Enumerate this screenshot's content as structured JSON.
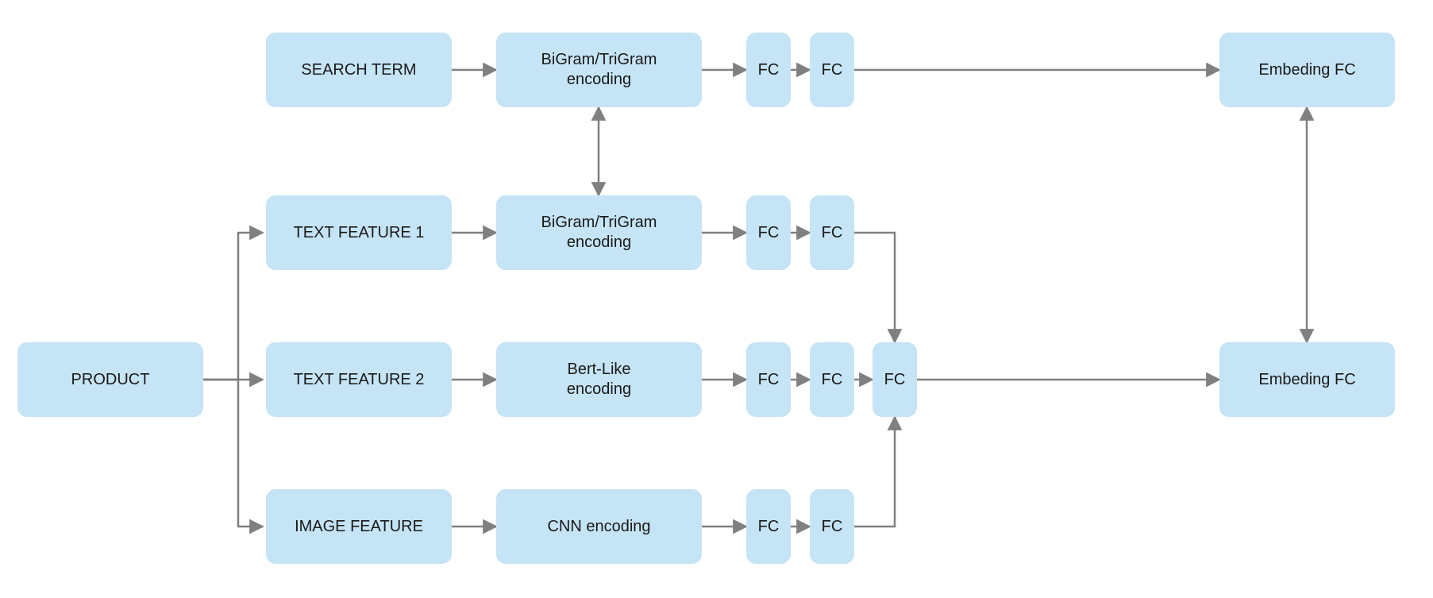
{
  "diagram": {
    "description": "Two-tower style embedding architecture: search term branch and product branch (text + image features) each pass through encoders and FC layers to produce embedding FCs.",
    "nodes": {
      "search_term": {
        "label": "SEARCH TERM"
      },
      "search_enc": {
        "label": "BiGram/TriGram\nencoding"
      },
      "search_fc1": {
        "label": "FC"
      },
      "search_fc2": {
        "label": "FC"
      },
      "search_emb": {
        "label": "Embeding FC"
      },
      "product": {
        "label": "PRODUCT"
      },
      "txt1": {
        "label": "TEXT FEATURE 1"
      },
      "txt1_enc": {
        "label": "BiGram/TriGram\nencoding"
      },
      "txt1_fc1": {
        "label": "FC"
      },
      "txt1_fc2": {
        "label": "FC"
      },
      "txt2": {
        "label": "TEXT FEATURE 2"
      },
      "txt2_enc": {
        "label": "Bert-Like\nencoding"
      },
      "txt2_fc1": {
        "label": "FC"
      },
      "txt2_fc2": {
        "label": "FC"
      },
      "img": {
        "label": "IMAGE FEATURE"
      },
      "img_enc": {
        "label": "CNN encoding"
      },
      "img_fc1": {
        "label": "FC"
      },
      "img_fc2": {
        "label": "FC"
      },
      "merge_fc": {
        "label": "FC"
      },
      "prod_emb": {
        "label": "Embeding FC"
      }
    },
    "colors": {
      "node_fill": "#C5E4F5",
      "arrow": "#808080"
    }
  }
}
